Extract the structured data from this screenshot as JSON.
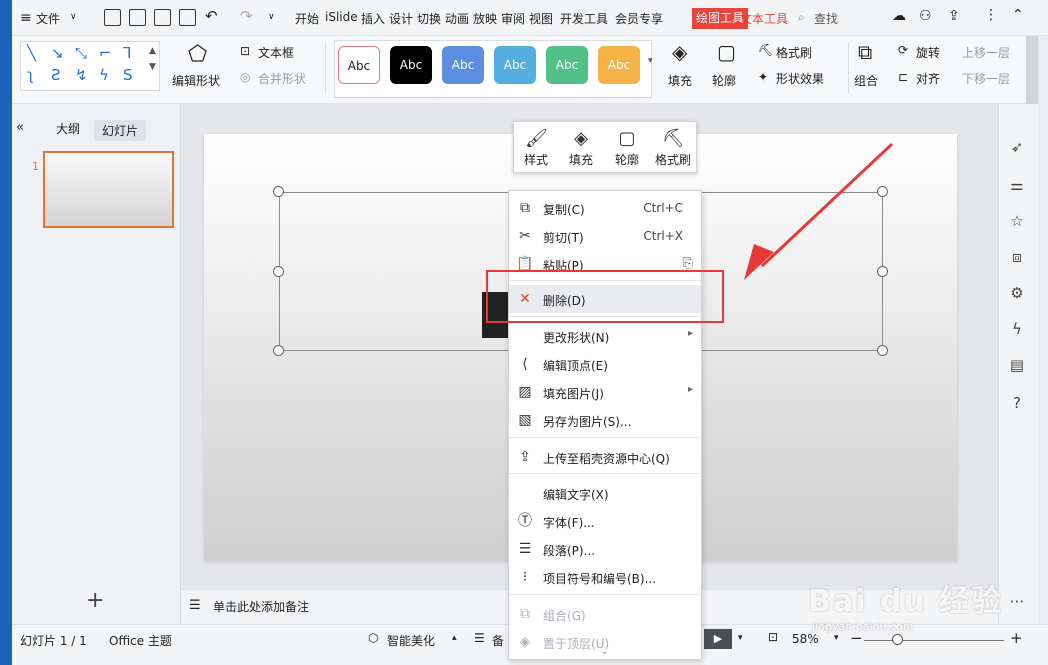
{
  "menubar": {
    "file": "文件",
    "tabs": [
      "开始",
      "iSlide",
      "插入",
      "设计",
      "切换",
      "动画",
      "放映",
      "审阅",
      "视图",
      "开发工具",
      "会员专享"
    ],
    "drawing_tools": "绘图工具",
    "text_tools": "文本工具",
    "search": "查找"
  },
  "ribbon": {
    "edit_shape": "编辑形状",
    "text_box": "文本框",
    "merge_shape": "合并形状",
    "styles": [
      "Abc",
      "Abc",
      "Abc",
      "Abc",
      "Abc",
      "Abc"
    ],
    "fill": "填充",
    "outline": "轮廓",
    "format_painter": "格式刷",
    "shape_effects": "形状效果",
    "group": "组合",
    "rotate": "旋转",
    "align": "对齐",
    "bring_forward": "上移一层",
    "send_backward": "下移一层"
  },
  "left_panel": {
    "outline_tab": "大纲",
    "slides_tab": "幻灯片",
    "slide_number": "1",
    "add": "+"
  },
  "float_toolbar": {
    "style": "样式",
    "fill": "填充",
    "outline": "轮廓",
    "format_painter": "格式刷"
  },
  "context_menu": {
    "items": [
      {
        "label": "复制(C)",
        "shortcut": "Ctrl+C"
      },
      {
        "label": "剪切(T)",
        "shortcut": "Ctrl+X"
      },
      {
        "label": "粘贴(P)",
        "shortcut": ""
      },
      {
        "label": "删除(D)",
        "shortcut": ""
      },
      {
        "label": "更改形状(N)",
        "shortcut": ""
      },
      {
        "label": "编辑顶点(E)",
        "shortcut": ""
      },
      {
        "label": "填充图片(J)",
        "shortcut": ""
      },
      {
        "label": "另存为图片(S)...",
        "shortcut": ""
      },
      {
        "label": "上传至稻壳资源中心(Q)",
        "shortcut": ""
      },
      {
        "label": "编辑文字(X)",
        "shortcut": ""
      },
      {
        "label": "字体(F)...",
        "shortcut": ""
      },
      {
        "label": "段落(P)...",
        "shortcut": ""
      },
      {
        "label": "项目符号和编号(B)...",
        "shortcut": ""
      },
      {
        "label": "组合(G)",
        "shortcut": ""
      },
      {
        "label": "置于顶层(U)",
        "shortcut": ""
      }
    ]
  },
  "notes": {
    "placeholder": "单击此处添加备注"
  },
  "status": {
    "slide_count": "幻灯片 1 / 1",
    "theme": "Office 主题",
    "smart_beautify": "智能美化",
    "notes_short": "备",
    "zoom": "58%"
  },
  "watermark": {
    "brand": "Bai du 经验",
    "url": "jingyan.baidu.com"
  },
  "colors": {
    "accent_red": "#e8443a",
    "highlight_border": "#e83737",
    "thumb_border": "#e2742f"
  }
}
